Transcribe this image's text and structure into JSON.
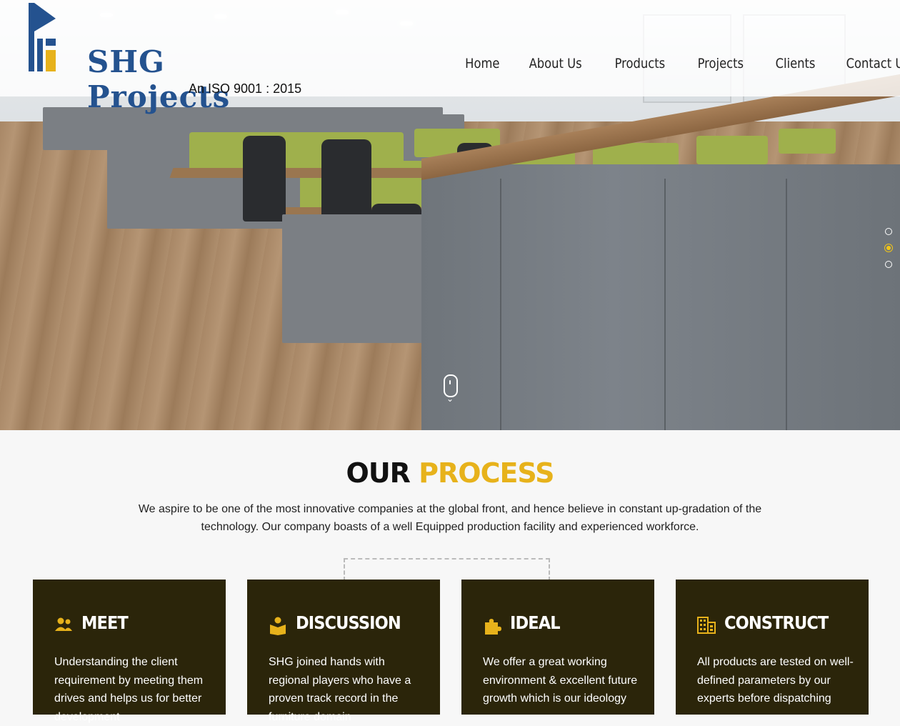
{
  "brand": {
    "name": "SHG Projects",
    "tagline": "An ISO 9001 : 2015"
  },
  "nav": {
    "items": [
      {
        "label": "Home"
      },
      {
        "label": "About Us"
      },
      {
        "label": "Products"
      },
      {
        "label": "Projects"
      },
      {
        "label": "Clients"
      },
      {
        "label": "Contact Us"
      }
    ]
  },
  "slider": {
    "dots": 3,
    "active_index": 1
  },
  "process": {
    "title_dark": "OUR",
    "title_accent": "PROCESS",
    "description": "We aspire to be one of the most innovative companies at the global front, and hence believe in constant up-gradation of the technology. Our company boasts of a well Equipped production facility and experienced workforce.",
    "cards": [
      {
        "icon": "users-icon",
        "title": "MEET",
        "text": "Understanding the client requirement by meeting them drives and helps us for better development"
      },
      {
        "icon": "book-reader-icon",
        "title": "DISCUSSION",
        "text": "SHG joined hands with regional players who have a proven track record in the furniture domain"
      },
      {
        "icon": "puzzle-icon",
        "title": "IDEAL",
        "text": "We offer a great working environment & excellent future growth which is our ideology"
      },
      {
        "icon": "building-icon",
        "title": "CONSTRUCT",
        "text": "All products are tested on well-defined parameters by our experts before dispatching"
      }
    ]
  },
  "colors": {
    "accent": "#e7b21b",
    "card_bg": "#2b250a",
    "brand_blue": "#24528f"
  }
}
